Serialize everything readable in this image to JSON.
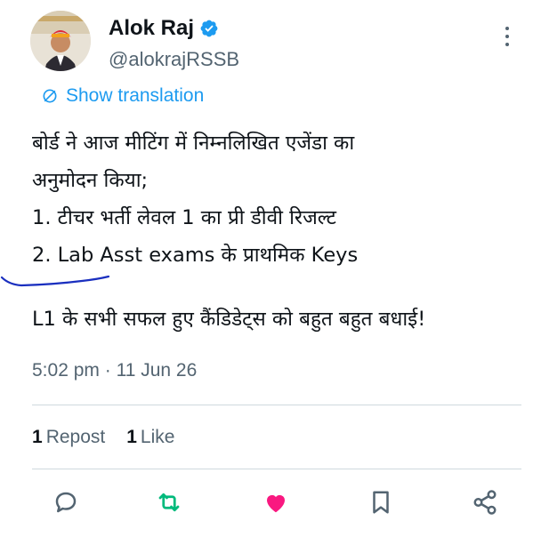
{
  "tweet": {
    "author_name": "Alok Raj",
    "author_handle": "@alokrajRSSB",
    "verified": true,
    "translate_label": "Show translation",
    "body_lines": [
      "बोर्ड ने आज मीटिंग में निम्नलिखित एजेंडा का",
      "अनुमोदन किया;",
      "1. टीचर भर्ती लेवल 1 का प्री डीवी रिजल्ट",
      "2. Lab Asst exams के प्राथमिक Keys",
      "",
      "L1 के सभी सफल हुए कैंडिडेट्स को बहुत बहुत बधाई!"
    ],
    "time": "5:02 pm",
    "separator": "·",
    "date": "11 Jun 26",
    "stats": {
      "reposts_count": "1",
      "reposts_label": "Repost",
      "likes_count": "1",
      "likes_label": "Like"
    },
    "liked": true
  },
  "icons": {
    "verified": "verified-badge-icon",
    "more": "more-options-icon",
    "translate": "translate-icon",
    "reply": "reply-icon",
    "repost": "repost-icon",
    "like": "like-icon",
    "bookmark": "bookmark-icon",
    "share": "share-icon"
  },
  "colors": {
    "accent": "#1d9bf0",
    "repost_green": "#00ba7c",
    "like_pink": "#f91880",
    "muted": "#536471",
    "annotation_ink": "#1a2fbf"
  }
}
